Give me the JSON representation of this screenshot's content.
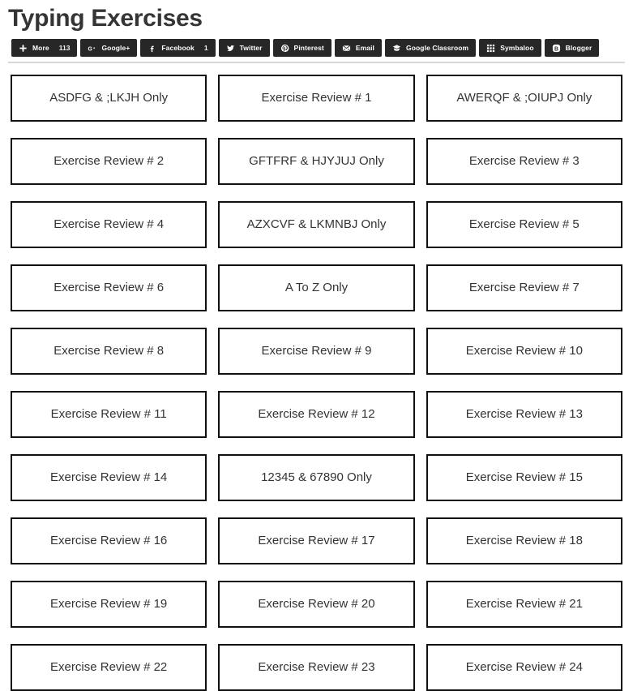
{
  "header": {
    "title": "Typing Exercises"
  },
  "share_bar": {
    "buttons": [
      {
        "icon": "plus-icon",
        "label": "More",
        "count": "113"
      },
      {
        "icon": "google-plus-icon",
        "label": "Google+",
        "count": ""
      },
      {
        "icon": "facebook-icon",
        "label": "Facebook",
        "count": "1"
      },
      {
        "icon": "twitter-icon",
        "label": "Twitter",
        "count": ""
      },
      {
        "icon": "pinterest-icon",
        "label": "Pinterest",
        "count": ""
      },
      {
        "icon": "email-icon",
        "label": "Email",
        "count": ""
      },
      {
        "icon": "google-classroom-icon",
        "label": "Google Classroom",
        "count": ""
      },
      {
        "icon": "symbaloo-icon",
        "label": "Symbaloo",
        "count": ""
      },
      {
        "icon": "blogger-icon",
        "label": "Blogger",
        "count": ""
      }
    ]
  },
  "main": {
    "tiles": [
      {
        "label": "ASDFG & ;LKJH Only"
      },
      {
        "label": "Exercise Review # 1"
      },
      {
        "label": "AWERQF & ;OIUPJ Only"
      },
      {
        "label": "Exercise Review # 2"
      },
      {
        "label": "GFTFRF & HJYJUJ Only"
      },
      {
        "label": "Exercise Review # 3"
      },
      {
        "label": "Exercise Review # 4"
      },
      {
        "label": "AZXCVF & LKMNBJ Only"
      },
      {
        "label": "Exercise Review # 5"
      },
      {
        "label": "Exercise Review # 6"
      },
      {
        "label": "A To Z Only"
      },
      {
        "label": "Exercise Review # 7"
      },
      {
        "label": "Exercise Review # 8"
      },
      {
        "label": "Exercise Review # 9"
      },
      {
        "label": "Exercise Review # 10"
      },
      {
        "label": "Exercise Review # 11"
      },
      {
        "label": "Exercise Review # 12"
      },
      {
        "label": "Exercise Review # 13"
      },
      {
        "label": "Exercise Review # 14"
      },
      {
        "label": "12345 & 67890 Only"
      },
      {
        "label": "Exercise Review # 15"
      },
      {
        "label": "Exercise Review # 16"
      },
      {
        "label": "Exercise Review # 17"
      },
      {
        "label": "Exercise Review # 18"
      },
      {
        "label": "Exercise Review # 19"
      },
      {
        "label": "Exercise Review # 20"
      },
      {
        "label": "Exercise Review # 21"
      },
      {
        "label": "Exercise Review # 22"
      },
      {
        "label": "Exercise Review # 23"
      },
      {
        "label": "Exercise Review # 24"
      }
    ]
  },
  "colors": {
    "share_button_bg": "#272727",
    "tile_border": "#111111",
    "text": "#333333",
    "divider": "#d8d8d8"
  }
}
